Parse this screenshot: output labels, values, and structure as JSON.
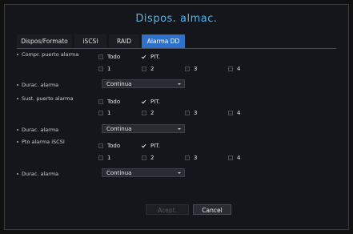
{
  "dialog": {
    "title": "Dispos. almac."
  },
  "tabs": [
    {
      "label": "Dispos/Formato"
    },
    {
      "label": "iSCSI"
    },
    {
      "label": "RAID"
    },
    {
      "label": "Alarma DD"
    }
  ],
  "sections": [
    {
      "label": "Compr. puerto alarma",
      "todo": "Todo",
      "pit": "PIT.",
      "ports": [
        "1",
        "2",
        "3",
        "4"
      ],
      "todo_checked": false,
      "pit_checked": true,
      "duration_label": "Durac. alarma",
      "duration_value": "Continua"
    },
    {
      "label": "Sust. puerto alarma",
      "todo": "Todo",
      "pit": "PIT.",
      "ports": [
        "1",
        "2",
        "3",
        "4"
      ],
      "todo_checked": false,
      "pit_checked": true,
      "duration_label": "Durac. alarma",
      "duration_value": "Continua"
    },
    {
      "label": "Pto alarma iSCSI",
      "todo": "Todo",
      "pit": "PIT.",
      "ports": [
        "1",
        "2",
        "3",
        "4"
      ],
      "todo_checked": false,
      "pit_checked": true,
      "duration_label": "Durac. alarma",
      "duration_value": "Continua"
    }
  ],
  "buttons": {
    "accept": "Acept.",
    "cancel": "Cancel"
  }
}
